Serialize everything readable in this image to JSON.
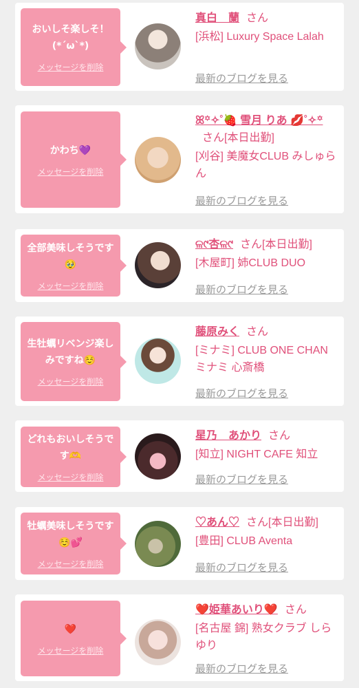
{
  "messages": [
    {
      "bubble_text": "おいしそ楽しそ！\n(*´ω`*)",
      "delete_label": "メッセージを削除",
      "name": "真白　蘭",
      "honorific": "さん",
      "badge": "",
      "shop": "[浜松] Luxury Space Lalah",
      "blog_link": "最新のブログを見る"
    },
    {
      "bubble_text": "かわち💜",
      "delete_label": "メッセージを削除",
      "name": "ꕤ꙳✧˚🍓 雪月 りあ 💋˚✧꙳",
      "honorific": "さん",
      "badge": "[本日出勤]",
      "shop": "[刈谷] 美魔女CLUB みしゅらん",
      "blog_link": "最新のブログを見る"
    },
    {
      "bubble_text": "全部美味しそうです🥹",
      "delete_label": "メッセージを削除",
      "name": "ଳ୯杏ଳ୯",
      "honorific": "さん",
      "badge": "[本日出勤]",
      "shop": "[木屋町] 姉CLUB DUO",
      "blog_link": "最新のブログを見る"
    },
    {
      "bubble_text": "生牡蠣リベンジ楽しみですね☺️",
      "delete_label": "メッセージを削除",
      "name": "藤原みく",
      "honorific": "さん",
      "badge": "",
      "shop": "[ミナミ] CLUB ONE CHAN ミナミ 心斎橋",
      "blog_link": "最新のブログを見る"
    },
    {
      "bubble_text": "どれもおいしそうです🫶",
      "delete_label": "メッセージを削除",
      "name": "星乃　あかり",
      "honorific": "さん",
      "badge": "",
      "shop": "[知立] NIGHT CAFE 知立",
      "blog_link": "最新のブログを見る"
    },
    {
      "bubble_text": "牡蠣美味しそうです☺️💕",
      "delete_label": "メッセージを削除",
      "name": "♡あん♡",
      "honorific": "さん",
      "badge": "[本日出勤]",
      "shop": "[豊田] CLUB Aventa",
      "blog_link": "最新のブログを見る"
    },
    {
      "bubble_text": "❤️",
      "delete_label": "メッセージを削除",
      "name": "❤️姫華あいり❤️",
      "honorific": "さん",
      "badge": "",
      "shop": "[名古屋 錦] 熟女クラブ しらゆり",
      "blog_link": "最新のブログを見る"
    }
  ],
  "colors": {
    "accent": "#e0507a",
    "bubble": "#f59aae",
    "link_gray": "#9a9a9a",
    "background": "#efefef"
  }
}
